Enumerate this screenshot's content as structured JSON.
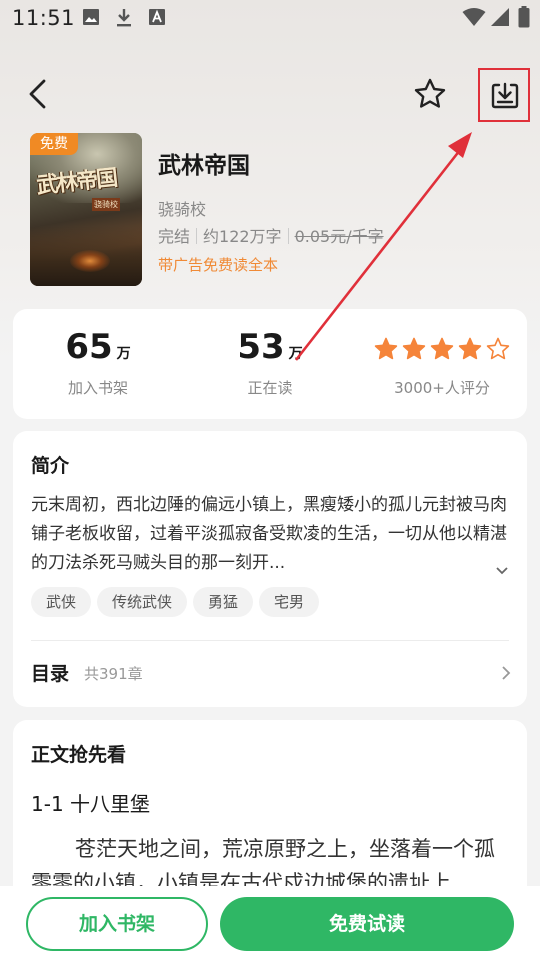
{
  "status_bar": {
    "time": "11:51",
    "left_icons": [
      "image-icon",
      "download-icon",
      "font-a-icon"
    ],
    "right_icons": [
      "wifi-icon",
      "signal-icon",
      "battery-icon"
    ]
  },
  "top_bar": {
    "icons": [
      "back-arrow-icon",
      "star-outline-icon",
      "download-tray-icon"
    ],
    "highlight_color": "#e0303a"
  },
  "book": {
    "badge": "免费",
    "title": "武林帝国",
    "author": "骁骑校",
    "status": "完结",
    "word_count": "约122万字",
    "price": "0.05元/千字",
    "promo": "带广告免费读全本",
    "cover_title_art": "武林帝国",
    "cover_sub_art": "骁骑校"
  },
  "stats": {
    "shelf": {
      "value": "65",
      "unit": "万",
      "label": "加入书架"
    },
    "reading": {
      "value": "53",
      "unit": "万",
      "label": "正在读"
    },
    "rating": {
      "label": "3000+人评分",
      "stars": 4,
      "max_stars": 5,
      "star_color": "#f5843a"
    }
  },
  "intro": {
    "title": "简介",
    "text": "元末周初，西北边陲的偏远小镇上，黑瘦矮小的孤儿元封被马肉铺子老板收留，过着平淡孤寂备受欺凌的生活，一切从他以精湛的刀法杀死马贼头目的那一刻开...",
    "tags": [
      "武侠",
      "传统武侠",
      "勇猛",
      "宅男"
    ]
  },
  "toc": {
    "label": "目录",
    "count": "共391章"
  },
  "preview": {
    "title": "正文抢先看",
    "chapter": "1-1 十八里堡",
    "text": "苍茫天地之间，荒凉原野之上，坐落着一个孤零零的小镇，小镇是在古代戍边城堡的遗址上"
  },
  "bottom": {
    "add_shelf": "加入书架",
    "free_read": "免费试读",
    "accent": "#2fb765"
  }
}
